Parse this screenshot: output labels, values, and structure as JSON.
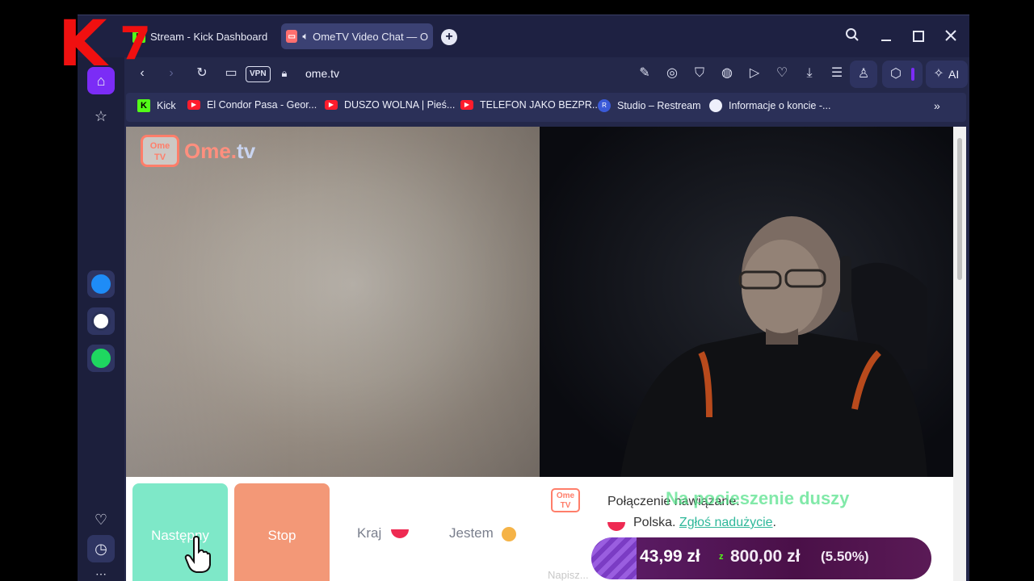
{
  "browser": {
    "tabs": [
      {
        "favicon": "kick-k",
        "title": "Stream - Kick Dashboard",
        "active": false
      },
      {
        "favicon": "ometv-tv",
        "title": "OmeTV Video Chat — O",
        "active": true,
        "audio": "speaker-icon"
      }
    ],
    "new_tab_label": "+",
    "window_controls": [
      "search-icon",
      "minimize-icon",
      "maximize-icon",
      "close-icon"
    ],
    "toolbar": {
      "vpn_label": "VPN",
      "url": "ome.tv",
      "ai_label": "AI",
      "icons": [
        "back-arrow-icon",
        "forward-arrow-icon",
        "reload-icon",
        "camera-icon",
        "lock-icon",
        "edit-icon",
        "screenshot-icon",
        "shield-icon",
        "translate-icon",
        "play-icon",
        "heart-icon",
        "download-icon",
        "settings-icon",
        "profile-icon",
        "cube-icon",
        "sparkle-icon"
      ]
    },
    "bookmarks": [
      {
        "favicon": "kick",
        "label": "Kick"
      },
      {
        "favicon": "youtube",
        "label": "El Condor Pasa - Geor..."
      },
      {
        "favicon": "youtube",
        "label": "DUSZO WOLNA | Pieś..."
      },
      {
        "favicon": "youtube",
        "label": "TELEFON JAKO BEZPR..."
      },
      {
        "favicon": "restream",
        "label": "Studio – Restream"
      },
      {
        "favicon": "spotify",
        "label": "Informacje o koncie -..."
      }
    ],
    "bookmarks_more": "»",
    "sidebar": [
      "home-icon",
      "star-icon",
      "messenger-icon",
      "whatsapp-icon",
      "spotify-icon",
      "heart-icon",
      "history-icon",
      "more-icon"
    ]
  },
  "ometv": {
    "logo_tv_text": "Ome\nTV",
    "logo_text_a": "Ome.",
    "logo_text_b": "tv",
    "next_button": "Następny",
    "stop_button": "Stop",
    "country_label": "Kraj",
    "gender_label": "Jestem",
    "chat_tv_text": "Ome\nTV",
    "status_text": "Połączenie nawiązane.",
    "country_text": "Polska.",
    "report_link": "Zgłoś nadużycie",
    "report_suffix": ".",
    "overlay_green_text": "Na pocieszenie duszy",
    "faint_text": "Napisz..."
  },
  "stream_overlay": {
    "logo_letter": "K",
    "logo_number": "7",
    "donation": {
      "amount": "43,99 zł",
      "separator": "z",
      "goal": "800,00 zł",
      "percent": "(5.50%)"
    }
  },
  "colors": {
    "browser_frame": "#24284a",
    "active_tab": "#3b4173",
    "accent_purple": "#7b2cf6",
    "next_button": "#7ee8c8",
    "stop_button": "#f39877",
    "report_link": "#2eb89a",
    "kick_green": "#53fc18",
    "overlay_red": "#f01010"
  }
}
